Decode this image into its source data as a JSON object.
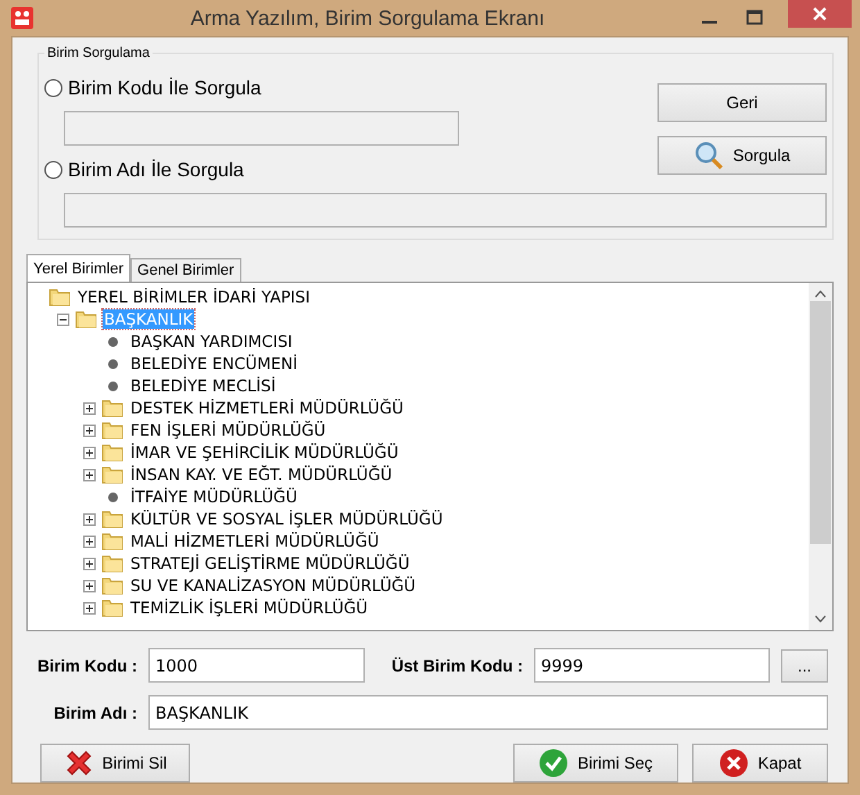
{
  "window": {
    "title": "Arma Yazılım, Birim Sorgulama Ekranı"
  },
  "query_group": {
    "title": "Birim Sorgulama",
    "options": [
      {
        "label": "Birim Kodu İle Sorgula",
        "selected": false
      },
      {
        "label": "Birim Adı İle Sorgula",
        "selected": false
      }
    ],
    "buttons": [
      {
        "label": "Geri",
        "kind": "plain"
      },
      {
        "label": "Sorgula",
        "kind": "search"
      }
    ]
  },
  "tabs": [
    {
      "label": "Yerel Birimler",
      "selected": true
    },
    {
      "label": "Genel Birimler",
      "selected": false
    }
  ],
  "tree": {
    "label": "YEREL BİRİMLER İDARİ YAPISI",
    "kind": "folder",
    "selected": false,
    "children": [
      {
        "label": "BAŞKANLIK",
        "kind": "folder",
        "expanded": true,
        "selected": true,
        "children": [
          {
            "label": "BAŞKAN YARDIMCISI",
            "kind": "leaf",
            "selected": false
          },
          {
            "label": "BELEDİYE ENCÜMENİ",
            "kind": "leaf",
            "selected": false
          },
          {
            "label": "BELEDİYE MECLİSİ",
            "kind": "leaf",
            "selected": false
          },
          {
            "label": "DESTEK HİZMETLERİ MÜDÜRLÜĞÜ",
            "kind": "folder",
            "expanded": false,
            "selected": false
          },
          {
            "label": "FEN İŞLERİ MÜDÜRLÜĞÜ",
            "kind": "folder",
            "expanded": false,
            "selected": false
          },
          {
            "label": "İMAR VE ŞEHİRCİLİK MÜDÜRLÜĞÜ",
            "kind": "folder",
            "expanded": false,
            "selected": false
          },
          {
            "label": "İNSAN KAY. VE EĞT. MÜDÜRLÜĞÜ",
            "kind": "folder",
            "expanded": false,
            "selected": false
          },
          {
            "label": "İTFAİYE MÜDÜRLÜĞÜ",
            "kind": "leaf",
            "selected": false
          },
          {
            "label": "KÜLTÜR VE SOSYAL İŞLER MÜDÜRLÜĞÜ",
            "kind": "folder",
            "expanded": false,
            "selected": false
          },
          {
            "label": "MALİ HİZMETLERİ MÜDÜRLÜĞÜ",
            "kind": "folder",
            "expanded": false,
            "selected": false
          },
          {
            "label": "STRATEJİ GELİŞTİRME MÜDÜRLÜĞÜ",
            "kind": "folder",
            "expanded": false,
            "selected": false
          },
          {
            "label": "SU VE KANALİZASYON MÜDÜRLÜĞÜ",
            "kind": "folder",
            "expanded": false,
            "selected": false
          },
          {
            "label": "TEMİZLİK İŞLERİ MÜDÜRLÜĞÜ",
            "kind": "folder",
            "expanded": false,
            "selected": false
          }
        ]
      }
    ]
  },
  "fields": {
    "unit_code": {
      "label": "Birim Kodu :",
      "value": "1000"
    },
    "parent_code": {
      "label": "Üst Birim Kodu :",
      "value": "9999",
      "button": "..."
    },
    "unit_name": {
      "label": "Birim Adı :",
      "value": "BAŞKANLIK"
    }
  },
  "actions": [
    {
      "label": "Birimi Sil",
      "kind": "delete"
    },
    {
      "label": "Birimi Seç",
      "kind": "select"
    },
    {
      "label": "Kapat",
      "kind": "close"
    }
  ]
}
